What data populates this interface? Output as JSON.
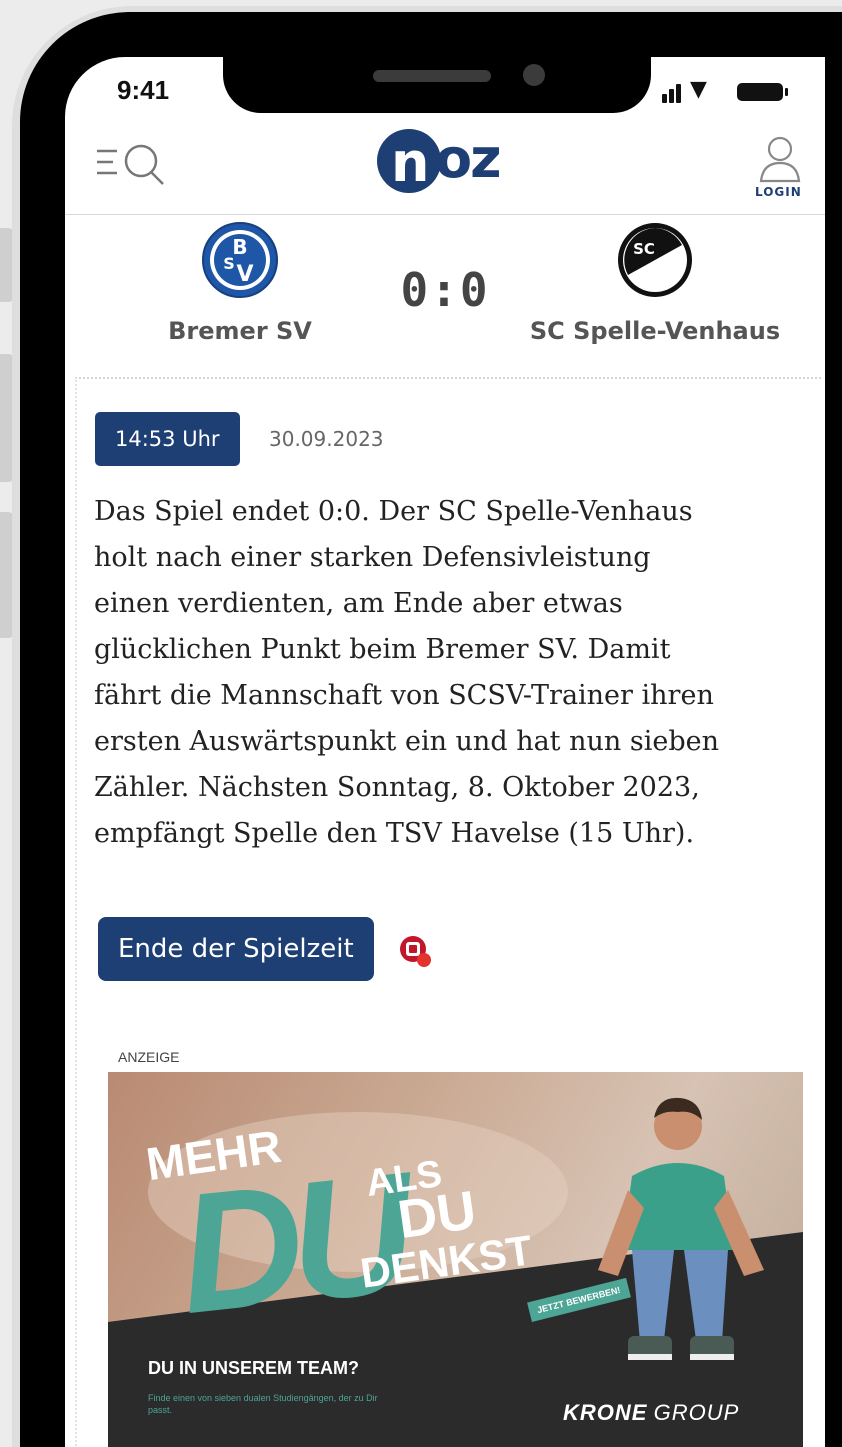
{
  "status_bar": {
    "time": "9:41"
  },
  "header": {
    "menu_search_icon": "menu-search-icon",
    "logo_text_n": "n",
    "logo_text_oz": "oz",
    "login_label": "LOGIN"
  },
  "match": {
    "home_team": "Bremer SV",
    "away_team": "SC Spelle-Venhaus",
    "score": "0:0",
    "away_crest_text": "SC"
  },
  "ticker": {
    "time_badge": "14:53 Uhr",
    "date": "30.09.2023",
    "text": "Das Spiel endet 0:0. Der SC Spelle-Venhaus holt nach einer starken Defensivleistung einen verdienten, am Ende aber etwas glücklichen Punkt beim Bremer SV. Damit fährt die Mannschaft von SCSV-Trainer ihren ersten Auswärtspunkt ein und hat nun sieben Zähler. Nächsten Sonntag, 8. Oktober 2023, empfängt Spelle den TSV Havelse (15 Uhr).",
    "end_button": "Ende der Spielzeit"
  },
  "ad": {
    "label": "ANZEIGE",
    "mehr": "MEHR",
    "du_big": "DU",
    "als": "ALS",
    "du_small": "DU",
    "denkst": "DENKST",
    "cta": "JETZT BEWERBEN!",
    "headline": "DU IN UNSEREM TEAM?",
    "subline": "Finde einen von sieben dualen Studiengängen, der zu Dir passt.",
    "brand_bold": "KRONE",
    "brand_light": "GROUP"
  },
  "colors": {
    "brand_blue": "#1d3f73",
    "ad_teal": "#4da595"
  }
}
